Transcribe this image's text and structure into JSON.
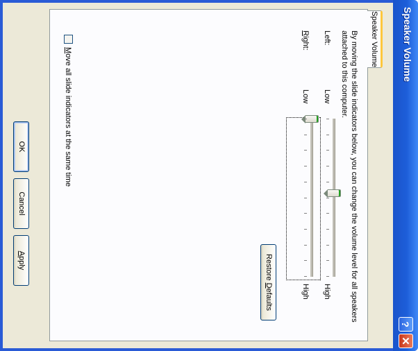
{
  "window": {
    "title": "Speaker Volume",
    "help_glyph": "?",
    "close_glyph": "✕"
  },
  "tab": {
    "label": "Speaker Volume"
  },
  "panel": {
    "description": "By moving the slide indicators below, you can change the volume level for all speakers attached to this computer.",
    "left_label": "Left:",
    "right_label_rest": "ight:",
    "right_label_accel": "R",
    "low_label": "Low",
    "high_label": "High",
    "left_slider": {
      "value_pct": 47,
      "tick_count": 11
    },
    "right_slider": {
      "value_pct": 0,
      "tick_count": 11
    },
    "checkbox_accel": "M",
    "checkbox_rest": "ove all slide indicators at the same time",
    "checkbox_checked": false,
    "restore_button_pre": "Restore ",
    "restore_button_accel": "D",
    "restore_button_post": "efaults"
  },
  "buttons": {
    "ok": "OK",
    "cancel": "Cancel",
    "apply_accel": "A",
    "apply_rest": "pply"
  },
  "colors": {
    "title_bar": "#2a5bd6",
    "dialog_bg": "#ece9d8",
    "tab_highlight": "#ffc73c",
    "slider_thumb_accent": "#21a121"
  }
}
